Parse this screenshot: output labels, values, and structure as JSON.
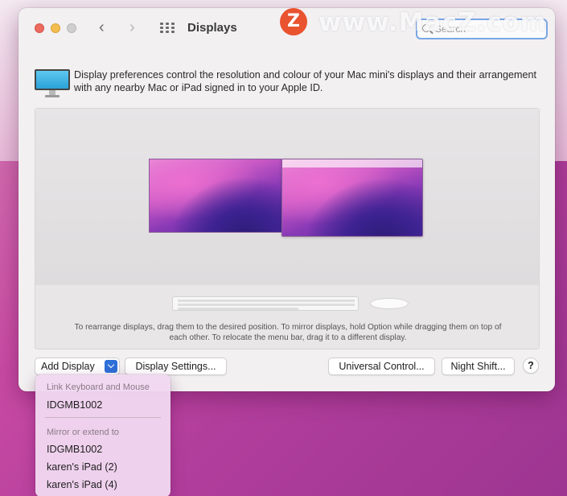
{
  "window": {
    "title": "Displays",
    "search_placeholder": "Search"
  },
  "watermark": {
    "badge": "Z",
    "text": "www.MacZ.com"
  },
  "intro": {
    "description": "Display preferences control the resolution and colour of your Mac mini's displays and their arrangement with any nearby Mac or iPad signed in to your Apple ID."
  },
  "arrangement": {
    "hint": "To rearrange displays, drag them to the desired position. To mirror displays, hold Option while dragging them on top of each other. To relocate the menu bar, drag it to a different display."
  },
  "buttons": {
    "add_display": "Add Display",
    "display_settings": "Display Settings...",
    "universal_control": "Universal Control...",
    "night_shift": "Night Shift...",
    "help": "?"
  },
  "dropdown": {
    "link_header": "Link Keyboard and Mouse",
    "link_items": [
      "IDGMB1002"
    ],
    "mirror_header": "Mirror or extend to",
    "mirror_items": [
      "IDGMB1002",
      "karen's iPad (2)",
      "karen's iPad (4)"
    ]
  },
  "colors": {
    "accent": "#2e6fd8",
    "close": "#ed6a5e",
    "minimize": "#f4be4f",
    "zoom_disabled": "#cfcfcf",
    "watermark_badge": "#e9532f"
  },
  "icons": [
    "back-chevron-icon",
    "forward-chevron-icon",
    "grid-icon",
    "search-icon",
    "monitor-icon",
    "chevron-down-icon"
  ]
}
